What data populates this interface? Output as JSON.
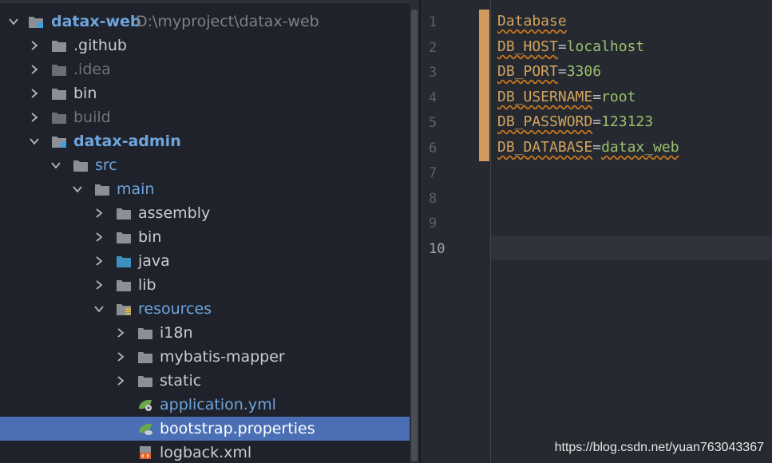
{
  "project_tree": {
    "root": {
      "name": "datax-web",
      "path": "D:\\myproject\\datax-web"
    },
    "items": [
      {
        "label": ".github"
      },
      {
        "label": ".idea"
      },
      {
        "label": "bin"
      },
      {
        "label": "build"
      },
      {
        "label": "datax-admin"
      },
      {
        "label": "src"
      },
      {
        "label": "main"
      },
      {
        "label": "assembly"
      },
      {
        "label": "bin"
      },
      {
        "label": "java"
      },
      {
        "label": "lib"
      },
      {
        "label": "resources"
      },
      {
        "label": "i18n"
      },
      {
        "label": "mybatis-mapper"
      },
      {
        "label": "static"
      },
      {
        "label": "application.yml"
      },
      {
        "label": "bootstrap.properties"
      },
      {
        "label": "logback.xml"
      }
    ],
    "selected_file": "bootstrap.properties"
  },
  "editor": {
    "line_numbers": [
      "1",
      "2",
      "3",
      "4",
      "5",
      "6",
      "7",
      "8",
      "9",
      "10"
    ],
    "current_line": "10",
    "lines": [
      {
        "key": "Database",
        "sep": "",
        "value": ""
      },
      {
        "key": "DB_HOST",
        "sep": "=",
        "value": "localhost"
      },
      {
        "key": "DB_PORT",
        "sep": "=",
        "value": "3306"
      },
      {
        "key": "DB_USERNAME",
        "sep": "=",
        "value": "root"
      },
      {
        "key": "DB_PASSWORD",
        "sep": "=",
        "value": "123123"
      },
      {
        "key": "DB_DATABASE",
        "sep": "=",
        "value": "datax_web"
      }
    ]
  },
  "watermark": "https://blog.csdn.net/yuan763043367",
  "colors": {
    "selection": "#4a6fb5",
    "module": "#6ea4dc",
    "change_marker": "#d29a5c",
    "key": "#d1a35f",
    "value": "#9bc16e"
  },
  "icons": [
    "chevron-down-icon",
    "chevron-right-icon",
    "folder-icon",
    "module-folder-icon",
    "source-folder-icon",
    "resources-folder-icon",
    "yml-file-icon",
    "properties-file-icon",
    "xml-file-icon"
  ]
}
